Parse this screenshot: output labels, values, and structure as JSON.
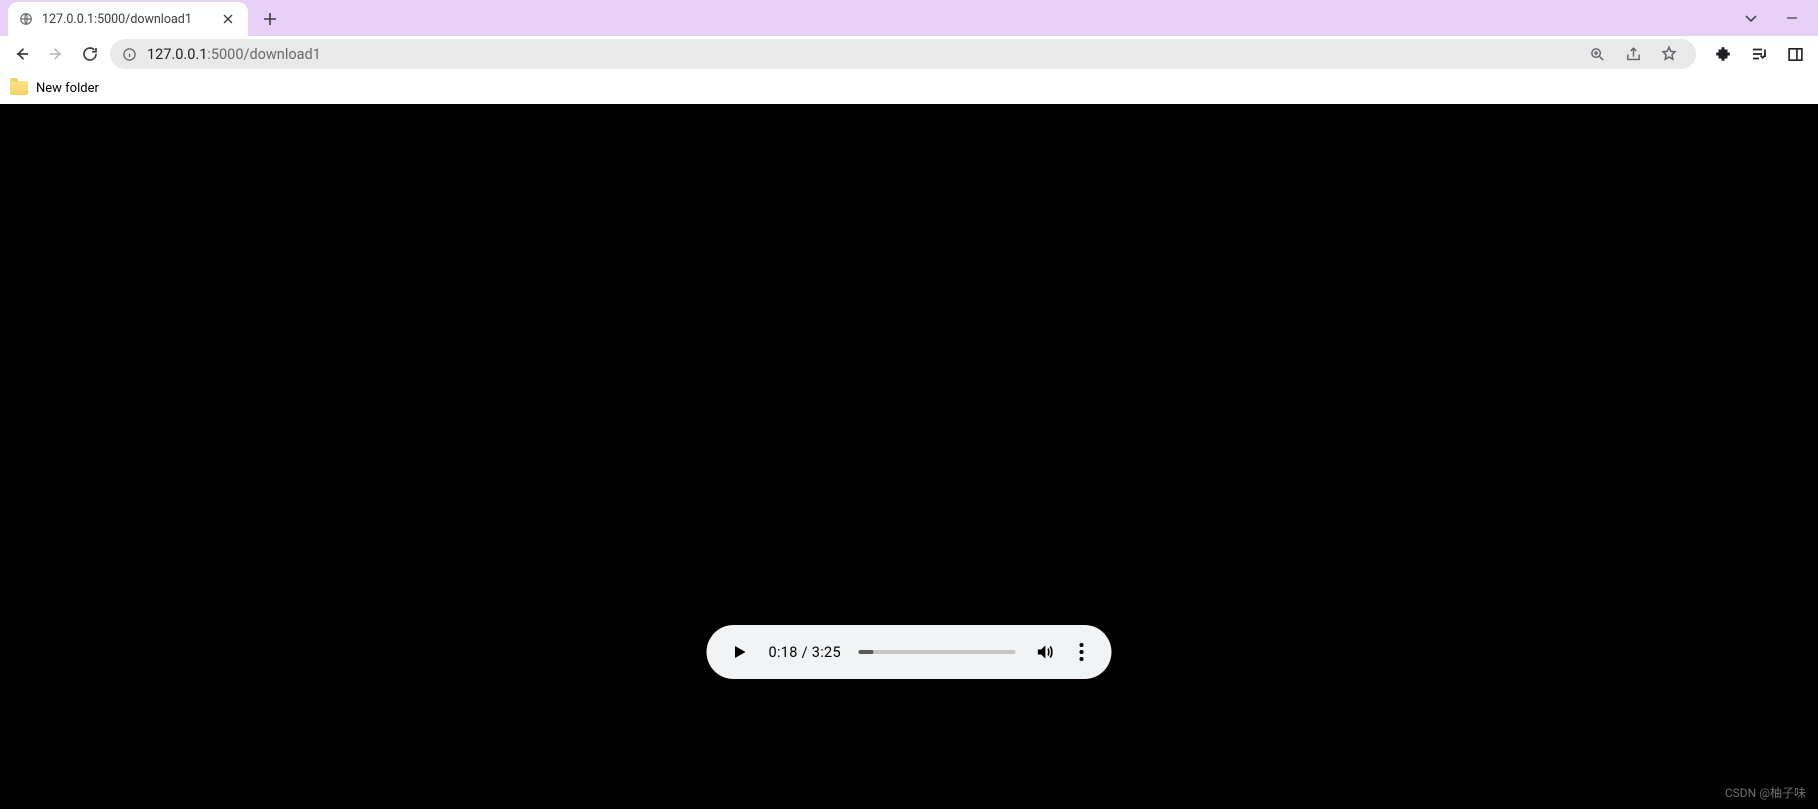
{
  "tab": {
    "title": "127.0.0.1:5000/download1"
  },
  "omnibox": {
    "host": "127.0.0.1",
    "path": ":5000/download1"
  },
  "bookmarks": {
    "items": [
      {
        "label": "New folder"
      }
    ]
  },
  "player": {
    "current_time": "0:18",
    "duration": "3:25",
    "progress_percent": 9
  },
  "watermark": "CSDN @柚子味"
}
